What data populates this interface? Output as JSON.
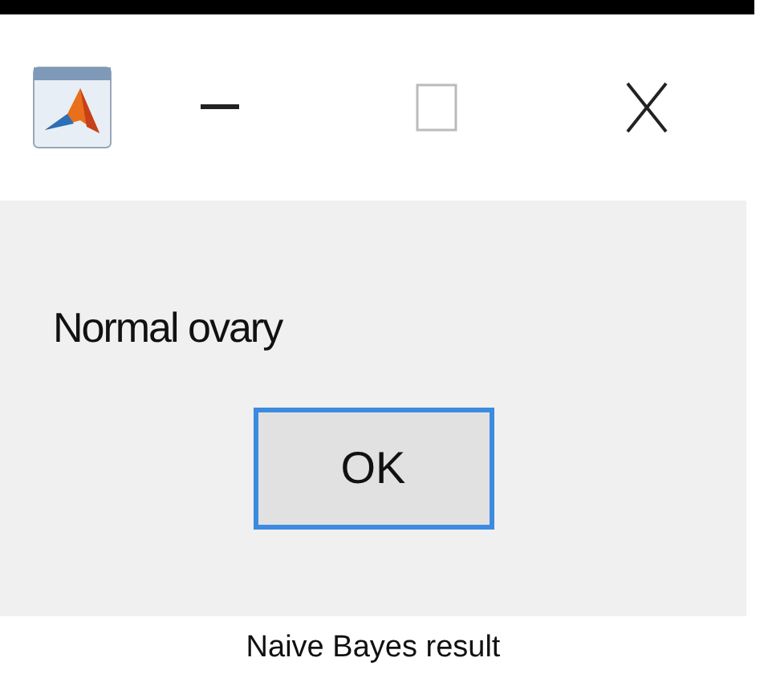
{
  "dialog": {
    "message": "Normal ovary",
    "buttons": [
      {
        "label": "OK",
        "focused": true
      }
    ]
  },
  "caption": "Naive Bayes result"
}
